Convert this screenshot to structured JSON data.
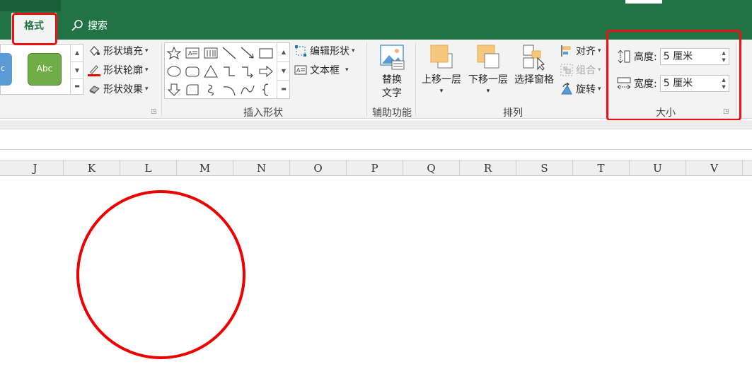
{
  "tabs": {
    "format_label": "格式",
    "search_label": "搜索"
  },
  "ribbon": {
    "shape_styles": {
      "style_blue_text": "c",
      "style_green_text": "Abc",
      "fill_label": "形状填充",
      "outline_label": "形状轮廓",
      "effects_label": "形状效果"
    },
    "insert_shapes": {
      "edit_shape_label": "编辑形状",
      "textbox_label": "文本框",
      "group_label": "插入形状"
    },
    "accessibility": {
      "alt_text_line1": "替换",
      "alt_text_line2": "文字",
      "group_label": "辅助功能"
    },
    "arrange": {
      "bring_forward_label": "上移一层",
      "send_backward_label": "下移一层",
      "selection_pane_label": "选择窗格",
      "align_label": "对齐",
      "group_cmd_label": "组合",
      "rotate_label": "旋转",
      "group_label": "排列"
    },
    "size": {
      "height_label": "高度:",
      "height_value": "5 厘米",
      "width_label": "宽度:",
      "width_value": "5 厘米",
      "group_label": "大小"
    }
  },
  "columns": [
    "J",
    "K",
    "L",
    "M",
    "N",
    "O",
    "P",
    "Q",
    "R",
    "S",
    "T",
    "U",
    "V"
  ],
  "colors": {
    "excel_green": "#217346",
    "highlight_red": "#ee1111",
    "circle_outline": "#ee0000"
  },
  "icons": [
    "search-icon",
    "shape-fill-icon",
    "shape-outline-icon",
    "shape-effects-icon",
    "edit-shape-icon",
    "textbox-icon",
    "alt-text-icon",
    "bring-forward-icon",
    "send-backward-icon",
    "selection-pane-icon",
    "align-icon",
    "group-icon",
    "rotate-icon",
    "height-icon",
    "width-icon",
    "dialog-launcher-icon"
  ]
}
